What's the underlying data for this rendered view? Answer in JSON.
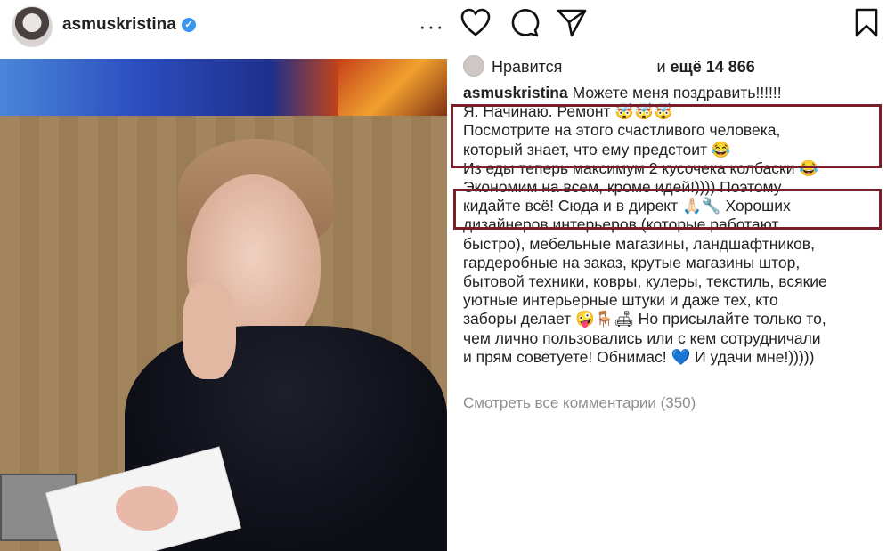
{
  "header": {
    "username": "asmuskristina",
    "verified_icon": "verified-badge-icon",
    "more_icon": "more-options-icon",
    "more_glyph": "···",
    "verified_glyph": "✓"
  },
  "actions": {
    "like_icon": "heart-icon",
    "comment_icon": "comment-icon",
    "share_icon": "send-icon",
    "save_icon": "bookmark-icon"
  },
  "likes": {
    "prefix": "Нравится",
    "suffix": "и",
    "count_text": "ещё 14 866"
  },
  "caption": {
    "username": "asmuskristina",
    "lines": [
      "Можете меня поздравить!!!!!!",
      "Я. Начинаю. Ремонт 🤯🤯🤯",
      "Посмотрите на этого счастливого человека,",
      "который знает, что ему предстоит 😂",
      "Из еды теперь максимум 2 кусочека колбаски 😂",
      "Экономим на всем, кроме идей!)))) Поэтому",
      "кидайте всё! Сюда и в директ 🙏🏻🔧 Хороших",
      "дизайнеров интерьеров (которые работают",
      "быстро), мебельные магазины, ландшафтников,",
      "гардеробные на заказ, крутые магазины штор,",
      "бытовой техники, ковры, кулеры, текстиль, всякие",
      "уютные интерьерные штуки и даже тех, кто",
      "заборы делает 🤪🪑🛋 Но присылайте только то,",
      "чем лично пользовались или с кем сотрудничали",
      "и прям советуете! Обнимас! 💙 И удачи мне!)))))"
    ]
  },
  "comments_link": "Смотреть все комментарии (350)",
  "colors": {
    "highlight_border": "#7a1f2a",
    "verified": "#3897f0",
    "muted": "#8e8e8e"
  }
}
